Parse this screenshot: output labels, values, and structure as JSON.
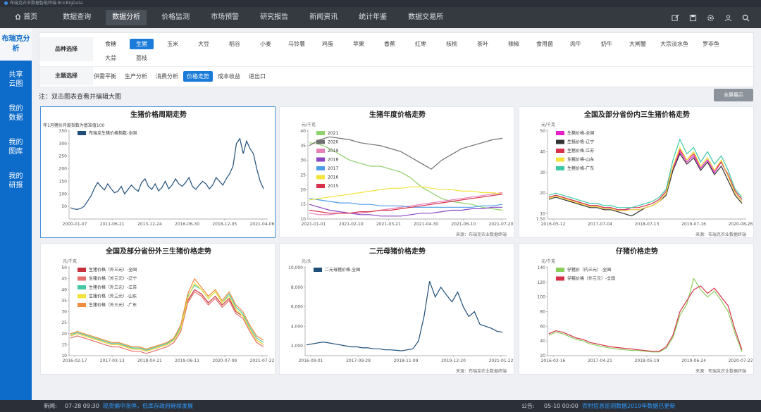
{
  "app_title": "布瑞克农业数据智能终端 BricBigData",
  "nav": {
    "home": "首页",
    "items": [
      "数据查询",
      "数据分析",
      "价格监测",
      "市场预警",
      "研究报告",
      "新闻资讯",
      "统计年鉴",
      "数据交易所"
    ],
    "active_index": 1,
    "icons": [
      "edit-icon",
      "save-icon",
      "settings-icon",
      "user-icon",
      "search-icon"
    ]
  },
  "sidebar": {
    "header": "布瑞克分析",
    "items": [
      "共享云图",
      "我的数据",
      "我的图库",
      "我的研报"
    ]
  },
  "filters": {
    "variety_label": "品种选择",
    "varieties_row1": [
      "生猪",
      "玉米",
      "大豆",
      "稻谷",
      "小麦",
      "马铃薯",
      "鸡蛋",
      "苹果",
      "香蕉",
      "红枣",
      "核桃",
      "茶叶",
      "辣椒",
      "食用菌",
      "肉牛",
      "奶牛",
      "大闸蟹",
      "大宗淡水鱼",
      "罗非鱼",
      "大蒜"
    ],
    "variety_first": "食糖",
    "varieties_row2": [
      "荔枝"
    ],
    "variety_active": "生猪",
    "theme_label": "主题选择",
    "themes": [
      "供需平衡",
      "生产分析",
      "消费分析",
      "价格走势",
      "成本收益",
      "进出口"
    ],
    "theme_active": "价格走势"
  },
  "note": "注：双击图表查看并编辑大图",
  "fullscreen_button": "全屏展示",
  "source_text": "来源：布瑞克农业数据终端",
  "colors": {
    "nav_bg": "#353a41",
    "accent": "#1a7bd8",
    "sidebar_bg": "#0d6bc9"
  },
  "chart_data": [
    {
      "type": "line",
      "title": "生猪价格周期走势",
      "subtitle": "年1月猪价月度指数为基准值100",
      "ylim": [
        0,
        350
      ],
      "yticks": [
        50,
        100,
        150,
        200,
        250,
        300,
        350
      ],
      "xticklabels": [
        "2000-01-07",
        "2011-06-21",
        "2013-12-24",
        "2016-06-30",
        "2018-12-05",
        "2021-04-06"
      ],
      "series": [
        {
          "name": "布瑞克生猪价格指数-全国",
          "color": "#1f4e79",
          "values": [
            45,
            40,
            38,
            42,
            50,
            70,
            90,
            120,
            145,
            130,
            115,
            140,
            120,
            105,
            110,
            130,
            100,
            118,
            135,
            120,
            110,
            145,
            160,
            130,
            118,
            140,
            112,
            125,
            150,
            120,
            135,
            160,
            140,
            130,
            145,
            165,
            130,
            118,
            135,
            150,
            140,
            120,
            135,
            165,
            150,
            135,
            160,
            180,
            210,
            300,
            320,
            260,
            310,
            280,
            260,
            200,
            150,
            120
          ]
        }
      ],
      "show_source": false
    },
    {
      "type": "line",
      "title": "生猪年度价格走势",
      "yunit": "元/千克",
      "ylim": [
        10,
        40
      ],
      "yticks": [
        10,
        15,
        20,
        25,
        30,
        35,
        40
      ],
      "xticklabels": [
        "2021-01-01",
        "2021-02-10",
        "2021-03-21",
        "2021-04-30",
        "2021-06-10",
        "2021-07-20"
      ],
      "series": [
        {
          "name": "2021",
          "color": "#8fd16d",
          "values": [
            36,
            35.5,
            34,
            32,
            30,
            29,
            28,
            28,
            27,
            26,
            24,
            21,
            19,
            17,
            16,
            15.5,
            15,
            14,
            13.5,
            13
          ]
        },
        {
          "name": "2020",
          "color": "#707070",
          "values": [
            35,
            37,
            38,
            37.5,
            37,
            36,
            35.5,
            35,
            34,
            33,
            31,
            29,
            27,
            30,
            32,
            34,
            35,
            36,
            37,
            37.5
          ]
        },
        {
          "name": "2019",
          "color": "#e77fb8",
          "values": [
            12,
            11.5,
            11.5,
            12,
            12,
            12,
            12.5,
            13,
            13.5,
            14,
            14.5,
            15,
            15.5,
            16,
            16.5,
            17,
            17.5,
            18,
            18.5,
            19
          ]
        },
        {
          "name": "2018",
          "color": "#8b46c2",
          "values": [
            15,
            14,
            13,
            12.5,
            12,
            11.5,
            11.5,
            11,
            11,
            11,
            11.5,
            12,
            12,
            12.5,
            13,
            13,
            13.5,
            13.5,
            14,
            14
          ]
        },
        {
          "name": "2017",
          "color": "#4f9de8",
          "values": [
            17,
            16.5,
            16,
            15.5,
            15.5,
            15,
            15,
            14.5,
            14.5,
            14.5,
            14,
            14,
            14,
            14,
            14,
            14,
            14,
            14.5,
            14.5,
            15
          ]
        },
        {
          "name": "2016",
          "color": "#f3e33a",
          "values": [
            16.5,
            17,
            17.5,
            18,
            18.5,
            19,
            19.5,
            20,
            20.5,
            20.5,
            21,
            21,
            20.5,
            20,
            20,
            19.5,
            19.5,
            19,
            19,
            18.5
          ]
        },
        {
          "name": "2015",
          "color": "#d6304b",
          "values": [
            13,
            12.5,
            12,
            12,
            12,
            12.5,
            12.5,
            13,
            13,
            13.5,
            14,
            14.5,
            15,
            15.5,
            16,
            16.5,
            17,
            17.5,
            18,
            18.5
          ]
        }
      ],
      "show_source": true
    },
    {
      "type": "line",
      "title": "全国及部分省份内三生猪价格走势",
      "yunit": "元/千克",
      "ylim": [
        7.5,
        50
      ],
      "yticks": [
        10,
        20,
        30,
        40,
        50
      ],
      "ytick_extra": "7.50",
      "xticklabels": [
        "2016-05-12",
        "2017-07-04",
        "2018-07-13",
        "2019-07-16",
        "2020-08-26"
      ],
      "series": [
        {
          "name": "生猪价格-全国",
          "color": "#e321c7",
          "values": [
            18,
            19,
            18,
            17,
            16,
            15,
            14,
            14,
            13,
            13,
            12,
            12,
            12,
            12,
            13,
            14,
            16,
            20,
            32,
            40,
            35,
            38,
            32,
            36,
            30,
            35,
            28,
            20,
            16
          ]
        },
        {
          "name": "生猪价格-辽宁",
          "color": "#333333",
          "values": [
            17,
            18,
            17,
            16,
            15,
            14,
            13,
            13,
            12,
            12,
            11,
            10,
            9,
            11,
            13,
            14,
            16,
            19,
            31,
            39,
            34,
            37,
            31,
            35,
            29,
            33,
            26,
            19,
            15
          ]
        },
        {
          "name": "生猪价格-江苏",
          "color": "#d6304b",
          "values": [
            18,
            19,
            18,
            17,
            16,
            15,
            14,
            14,
            13,
            13,
            12,
            12,
            13,
            13,
            14,
            15,
            17,
            21,
            33,
            41,
            36,
            39,
            33,
            37,
            31,
            35,
            29,
            21,
            17
          ]
        },
        {
          "name": "生猪价格-山东",
          "color": "#f3e33a",
          "values": [
            17.5,
            18.5,
            17.5,
            16.5,
            15.5,
            14.5,
            13.5,
            13.5,
            12.5,
            12.5,
            11.5,
            11.5,
            12,
            12,
            13,
            14,
            16,
            20,
            33,
            42,
            36,
            40,
            33,
            37,
            31,
            36,
            28,
            20,
            16
          ]
        },
        {
          "name": "生猪价格-广东",
          "color": "#3cc9a7",
          "values": [
            19,
            20,
            19,
            18,
            17,
            16,
            15,
            15,
            14,
            14,
            13,
            13,
            13,
            14,
            15,
            16,
            18,
            22,
            36,
            46,
            39,
            42,
            35,
            40,
            34,
            38,
            31,
            22,
            18
          ]
        }
      ],
      "show_source": true
    },
    {
      "type": "line",
      "title": "全国及部分省份外三生猪价格走势",
      "yunit": "元/千克",
      "ylim": [
        10,
        50
      ],
      "yticks": [
        10,
        15,
        20,
        25,
        30,
        35,
        40,
        45,
        50
      ],
      "xticklabels": [
        "2016-02-17",
        "2017-03-13",
        "2018-04-21",
        "2019-06-11",
        "2020-07-09",
        "2021-07-22"
      ],
      "series": [
        {
          "name": "生猪价格（外三元）-全国",
          "color": "#c7313e",
          "values": [
            19,
            20,
            19,
            18,
            17,
            16,
            15,
            15,
            14,
            13,
            13,
            12,
            13,
            14,
            15,
            17,
            22,
            35,
            40,
            38,
            34,
            37,
            33,
            36,
            30,
            28,
            22,
            17,
            15
          ]
        },
        {
          "name": "生猪价格（外三元）-辽宁",
          "color": "#e56f6f",
          "values": [
            18,
            19,
            18,
            17,
            16,
            15,
            14,
            14,
            13,
            12,
            12,
            11,
            12,
            13,
            14,
            16,
            21,
            34,
            39,
            37,
            33,
            36,
            32,
            35,
            29,
            27,
            21,
            16,
            14
          ]
        },
        {
          "name": "生猪价格（外三元）-江苏",
          "color": "#46c7a8",
          "values": [
            19.5,
            20.5,
            19.5,
            18.5,
            17.5,
            16.5,
            15.5,
            15.5,
            14.5,
            13.5,
            13.5,
            12.5,
            13.5,
            14.5,
            15.5,
            17.5,
            23,
            37,
            42,
            40,
            36,
            39,
            34,
            38,
            32,
            29,
            23,
            18,
            16
          ]
        },
        {
          "name": "生猪价格（外三元）-山东",
          "color": "#f3e33a",
          "values": [
            19,
            20,
            19,
            18,
            17,
            16,
            15,
            15,
            14,
            13,
            13,
            12,
            13,
            14,
            15,
            17,
            22,
            36,
            43,
            40,
            36,
            39,
            34,
            37,
            31,
            28,
            22,
            17,
            15
          ]
        },
        {
          "name": "生猪价格（外三元）-广东",
          "color": "#f08c3c",
          "values": [
            20,
            21,
            20,
            19,
            18,
            17,
            16,
            16,
            15,
            14,
            14,
            13,
            14,
            15,
            16,
            18,
            24,
            38,
            45,
            41,
            37,
            40,
            35,
            39,
            33,
            30,
            24,
            19,
            17
          ]
        }
      ],
      "show_source": false
    },
    {
      "type": "line",
      "title": "二元母猪价格走势",
      "yunit": "元/头",
      "ylim": [
        1000,
        10000
      ],
      "yticks": [
        2000,
        4000,
        6000,
        8000,
        10000
      ],
      "yticklabels": [
        "2,000",
        "4,000",
        "6,000",
        "8,000",
        "10,000"
      ],
      "xticklabels": [
        "2016-09-01",
        "2017-09-29",
        "2018-11-09",
        "2019-12-20",
        "2021-01-22"
      ],
      "series": [
        {
          "name": "二元母猪价格-全国",
          "color": "#1f4e79",
          "values": [
            2100,
            2200,
            2300,
            2400,
            2300,
            2200,
            2100,
            2000,
            1900,
            1900,
            1800,
            1800,
            1700,
            1700,
            1600,
            1600,
            1550,
            1500,
            1600,
            1700,
            2500,
            5000,
            8600,
            7000,
            8000,
            7200,
            6500,
            7500,
            6000,
            5000,
            5500,
            4200,
            4000,
            3800,
            3500,
            3400
          ]
        }
      ],
      "show_source": true
    },
    {
      "type": "line",
      "title": "仔猪价格走势",
      "yunit": "元/千克",
      "ylim": [
        20,
        140
      ],
      "yticks": [
        20,
        40,
        60,
        80,
        100,
        120,
        140
      ],
      "xticklabels": [
        "2016-03-16",
        "2017-04-21",
        "2018-05-19",
        "2019-06-24",
        "2020-07-22"
      ],
      "series": [
        {
          "name": "仔猪价（内三元）-全国",
          "color": "#8bcf5a",
          "values": [
            48,
            52,
            50,
            46,
            42,
            40,
            36,
            34,
            32,
            30,
            29,
            28,
            27,
            27,
            26,
            25,
            25,
            30,
            45,
            75,
            90,
            125,
            110,
            100,
            108,
            95,
            80,
            50,
            25
          ]
        },
        {
          "name": "仔猪价格（外三元）-全国",
          "color": "#d6304b",
          "values": [
            50,
            54,
            52,
            48,
            44,
            42,
            38,
            36,
            34,
            32,
            31,
            30,
            29,
            28,
            27,
            26,
            26,
            32,
            48,
            80,
            95,
            110,
            115,
            105,
            112,
            100,
            88,
            55,
            28
          ]
        }
      ],
      "show_source": true
    }
  ],
  "ticker": {
    "news_label": "新闻:",
    "news_time": "07-28 09:30",
    "news_text": "现货偏中涨停，低库存政府继续发展",
    "notice_label": "公告:",
    "notice_time": "05-10 00:00",
    "notice_text": "农村信息监测数据2019年数据已更新"
  }
}
